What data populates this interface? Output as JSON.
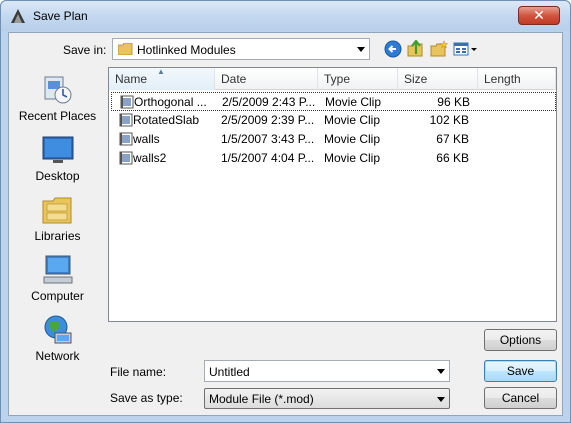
{
  "window": {
    "title": "Save Plan",
    "close_label": "✕"
  },
  "save_in": {
    "label": "Save in:",
    "value": "Hotlinked Modules"
  },
  "toolbar": {
    "back_icon": "back-arrow-icon",
    "up_icon": "up-folder-icon",
    "new_folder_icon": "new-folder-icon",
    "views_icon": "views-menu-icon"
  },
  "places": [
    {
      "label": "Recent Places",
      "icon": "recent-places-icon"
    },
    {
      "label": "Desktop",
      "icon": "desktop-icon"
    },
    {
      "label": "Libraries",
      "icon": "libraries-icon"
    },
    {
      "label": "Computer",
      "icon": "computer-icon"
    },
    {
      "label": "Network",
      "icon": "network-icon"
    }
  ],
  "file_list": {
    "columns": [
      "Name",
      "Date",
      "Type",
      "Size",
      "Length"
    ],
    "rows": [
      {
        "name": "Orthogonal ...",
        "date": "2/5/2009 2:43 P...",
        "type": "Movie Clip",
        "size": "96 KB",
        "length": "",
        "selected": true
      },
      {
        "name": "RotatedSlab",
        "date": "2/5/2009 2:39 P...",
        "type": "Movie Clip",
        "size": "102 KB",
        "length": "",
        "selected": false
      },
      {
        "name": "walls",
        "date": "1/5/2007 3:43 P...",
        "type": "Movie Clip",
        "size": "67 KB",
        "length": "",
        "selected": false
      },
      {
        "name": "walls2",
        "date": "1/5/2007 4:04 P...",
        "type": "Movie Clip",
        "size": "66 KB",
        "length": "",
        "selected": false
      }
    ]
  },
  "file_name": {
    "label": "File name:",
    "value": "Untitled"
  },
  "save_as_type": {
    "label": "Save as type:",
    "value": "Module File (*.mod)"
  },
  "buttons": {
    "options": "Options",
    "save": "Save",
    "cancel": "Cancel"
  }
}
